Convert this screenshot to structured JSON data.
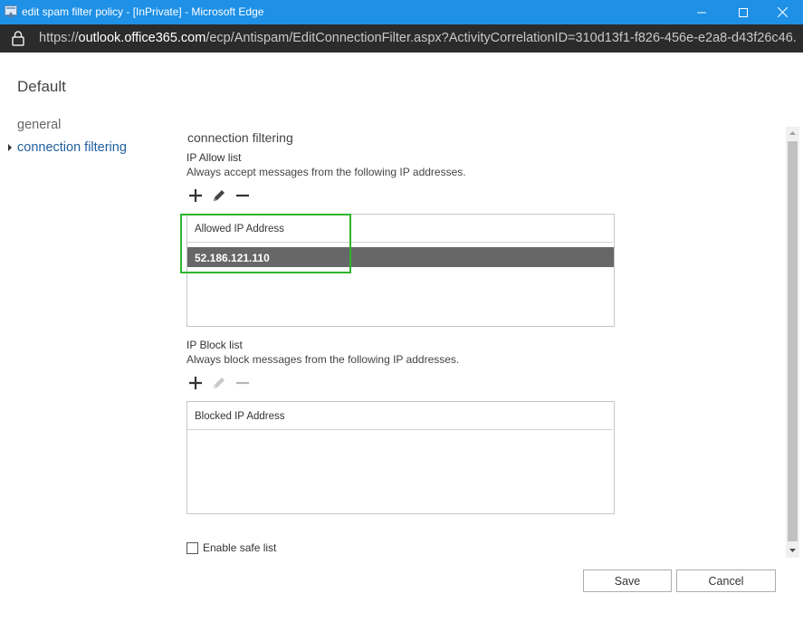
{
  "window": {
    "title": "edit spam filter policy - [InPrivate] - Microsoft Edge"
  },
  "address": {
    "scheme": "https://",
    "host": "outlook.office365.com",
    "path": "/ecp/Antispam/EditConnectionFilter.aspx?ActivityCorrelationID=310d13f1-f826-456e-e2a8-d43f26c46..."
  },
  "page": {
    "title": "Default"
  },
  "nav": {
    "items": [
      {
        "label": "general",
        "selected": false
      },
      {
        "label": "connection filtering",
        "selected": true
      }
    ]
  },
  "main": {
    "section_title": "connection filtering",
    "allow": {
      "label": "IP Allow list",
      "description": "Always accept messages from the following IP addresses.",
      "column_header": "Allowed IP Address",
      "rows": [
        "52.186.121.110"
      ]
    },
    "block": {
      "label": "IP Block list",
      "description": "Always block messages from the following IP addresses.",
      "column_header": "Blocked IP Address",
      "rows": []
    },
    "safe_list": {
      "label": "Enable safe list",
      "checked": false
    }
  },
  "buttons": {
    "save": "Save",
    "cancel": "Cancel"
  },
  "colors": {
    "titlebar": "#1e90e6",
    "addressbar": "#2b2b2b",
    "nav_selected": "#1e5e9e",
    "selected_row": "#676767",
    "highlight_box": "#2db52d"
  }
}
